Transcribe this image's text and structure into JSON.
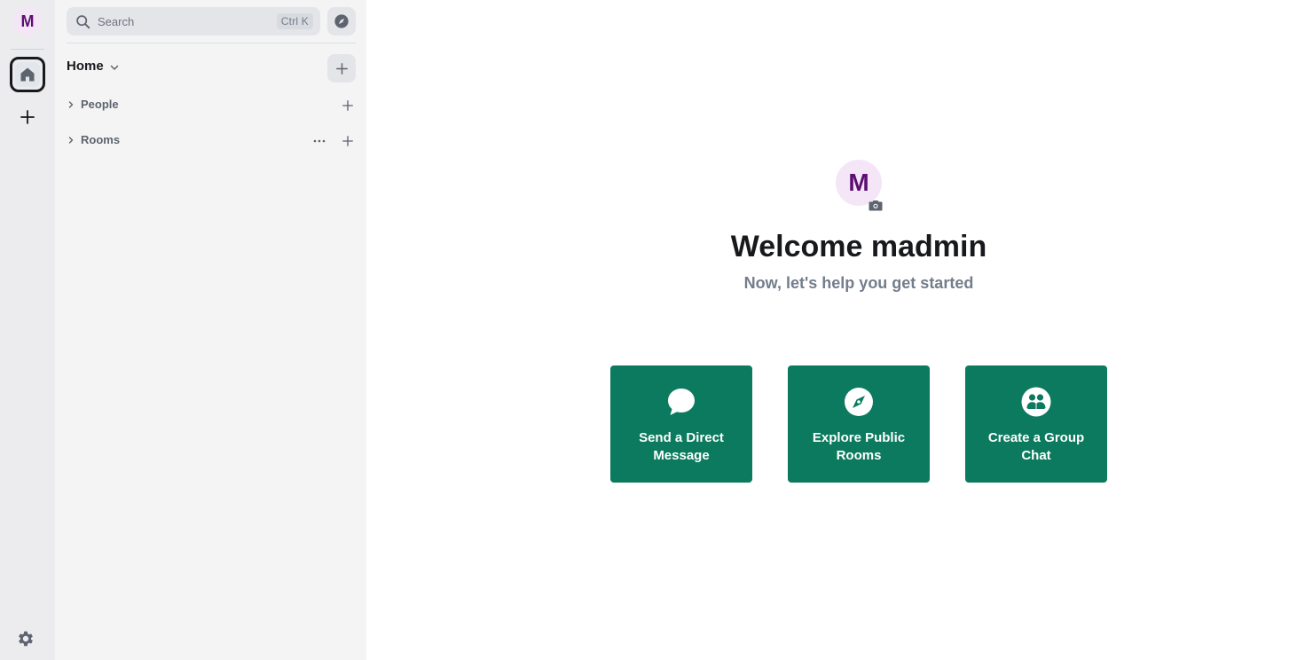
{
  "spacebar": {
    "user_initial": "M",
    "icons": [
      "home-icon",
      "plus-icon",
      "gear-icon"
    ]
  },
  "roomlist": {
    "search_label": "Search",
    "search_shortcut": "Ctrl K",
    "home_label": "Home",
    "sections": {
      "people": "People",
      "rooms": "Rooms"
    }
  },
  "main": {
    "avatar_initial": "M",
    "title": "Welcome madmin",
    "subtitle": "Now, let's help you get started",
    "actions": [
      {
        "label": "Send a Direct Message",
        "icon": "chat-bubble-icon"
      },
      {
        "label": "Explore Public Rooms",
        "icon": "compass-icon"
      },
      {
        "label": "Create a Group Chat",
        "icon": "group-icon"
      }
    ]
  },
  "colors": {
    "accent": "#0b7a5f",
    "avatar_bg": "#f4e6f7",
    "avatar_fg": "#5c0f73"
  }
}
